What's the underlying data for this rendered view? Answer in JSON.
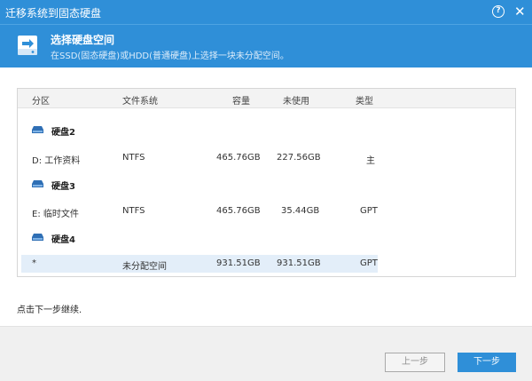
{
  "window": {
    "title": "迁移系统到固态硬盘",
    "help_label": "?",
    "close_label": "✕"
  },
  "header": {
    "title": "选择硬盘空间",
    "subtitle": "在SSD(固态硬盘)或HDD(普通硬盘)上选择一块未分配空间。",
    "icon": "disk-migrate-icon"
  },
  "table": {
    "columns": [
      "分区",
      "文件系统",
      "容量",
      "未使用",
      "类型"
    ],
    "disks": [
      {
        "label": "硬盘2",
        "icon": "hard-disk-icon",
        "partitions": [
          {
            "name": "D:  工作资料",
            "fs": "NTFS",
            "capacity": "465.76GB",
            "unused": "227.56GB",
            "type": "主",
            "selected": false
          }
        ]
      },
      {
        "label": "硬盘3",
        "icon": "hard-disk-icon",
        "partitions": [
          {
            "name": "E:  临时文件",
            "fs": "NTFS",
            "capacity": "465.76GB",
            "unused": "35.44GB",
            "type": "GPT",
            "selected": false
          }
        ]
      },
      {
        "label": "硬盘4",
        "icon": "hard-disk-icon",
        "partitions": [
          {
            "name": "*",
            "fs": "未分配空间",
            "capacity": "931.51GB",
            "unused": "931.51GB",
            "type": "GPT",
            "selected": true
          }
        ]
      }
    ]
  },
  "hint": "点击下一步继续.",
  "buttons": {
    "prev": "上一步",
    "next": "下一步"
  },
  "colors": {
    "accent": "#2f8fd8",
    "selection": "#e3eef9"
  }
}
